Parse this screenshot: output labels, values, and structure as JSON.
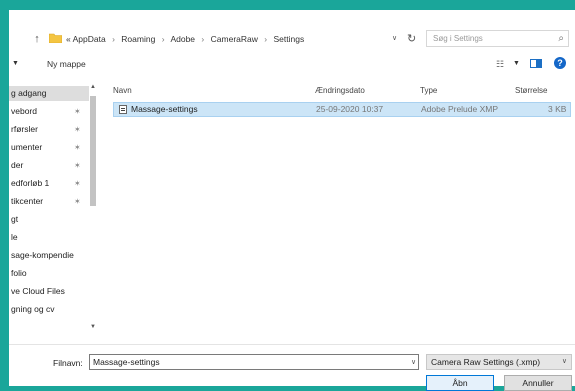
{
  "address_bar": {
    "crumbs": [
      "« AppData",
      "Roaming",
      "Adobe",
      "CameraRaw",
      "Settings"
    ],
    "separator": "›",
    "search_placeholder": "Søg i Settings"
  },
  "toolbar": {
    "new_folder_label": "Ny mappe"
  },
  "nav_pane": {
    "items": [
      {
        "label": "g adgang",
        "selected": true,
        "pinned": false
      },
      {
        "label": "vebord",
        "pinned": true
      },
      {
        "label": "rførsler",
        "pinned": true
      },
      {
        "label": "umenter",
        "pinned": true
      },
      {
        "label": "der",
        "pinned": true
      },
      {
        "label": "edforløb 1",
        "pinned": true
      },
      {
        "label": "tikcenter",
        "pinned": true
      },
      {
        "label": "gt",
        "pinned": false
      },
      {
        "label": "le",
        "pinned": false
      },
      {
        "label": "sage-kompendie",
        "pinned": false
      },
      {
        "label": "folio",
        "pinned": false
      },
      {
        "label": "ve Cloud Files",
        "pinned": false
      },
      {
        "label": "gning og cv",
        "pinned": false
      }
    ]
  },
  "file_list": {
    "columns": [
      "Navn",
      "Ændringsdato",
      "Type",
      "Størrelse"
    ],
    "rows": [
      {
        "name": "Massage-settings",
        "modified": "25-09-2020 10:37",
        "type": "Adobe Prelude XMP",
        "size": "3 KB",
        "selected": true
      }
    ]
  },
  "footer": {
    "filename_label": "Filnavn:",
    "filename_value": "Massage-settings",
    "filetype_value": "Camera Raw Settings (.xmp)",
    "open_label": "Åbn",
    "cancel_label": "Annuller"
  }
}
